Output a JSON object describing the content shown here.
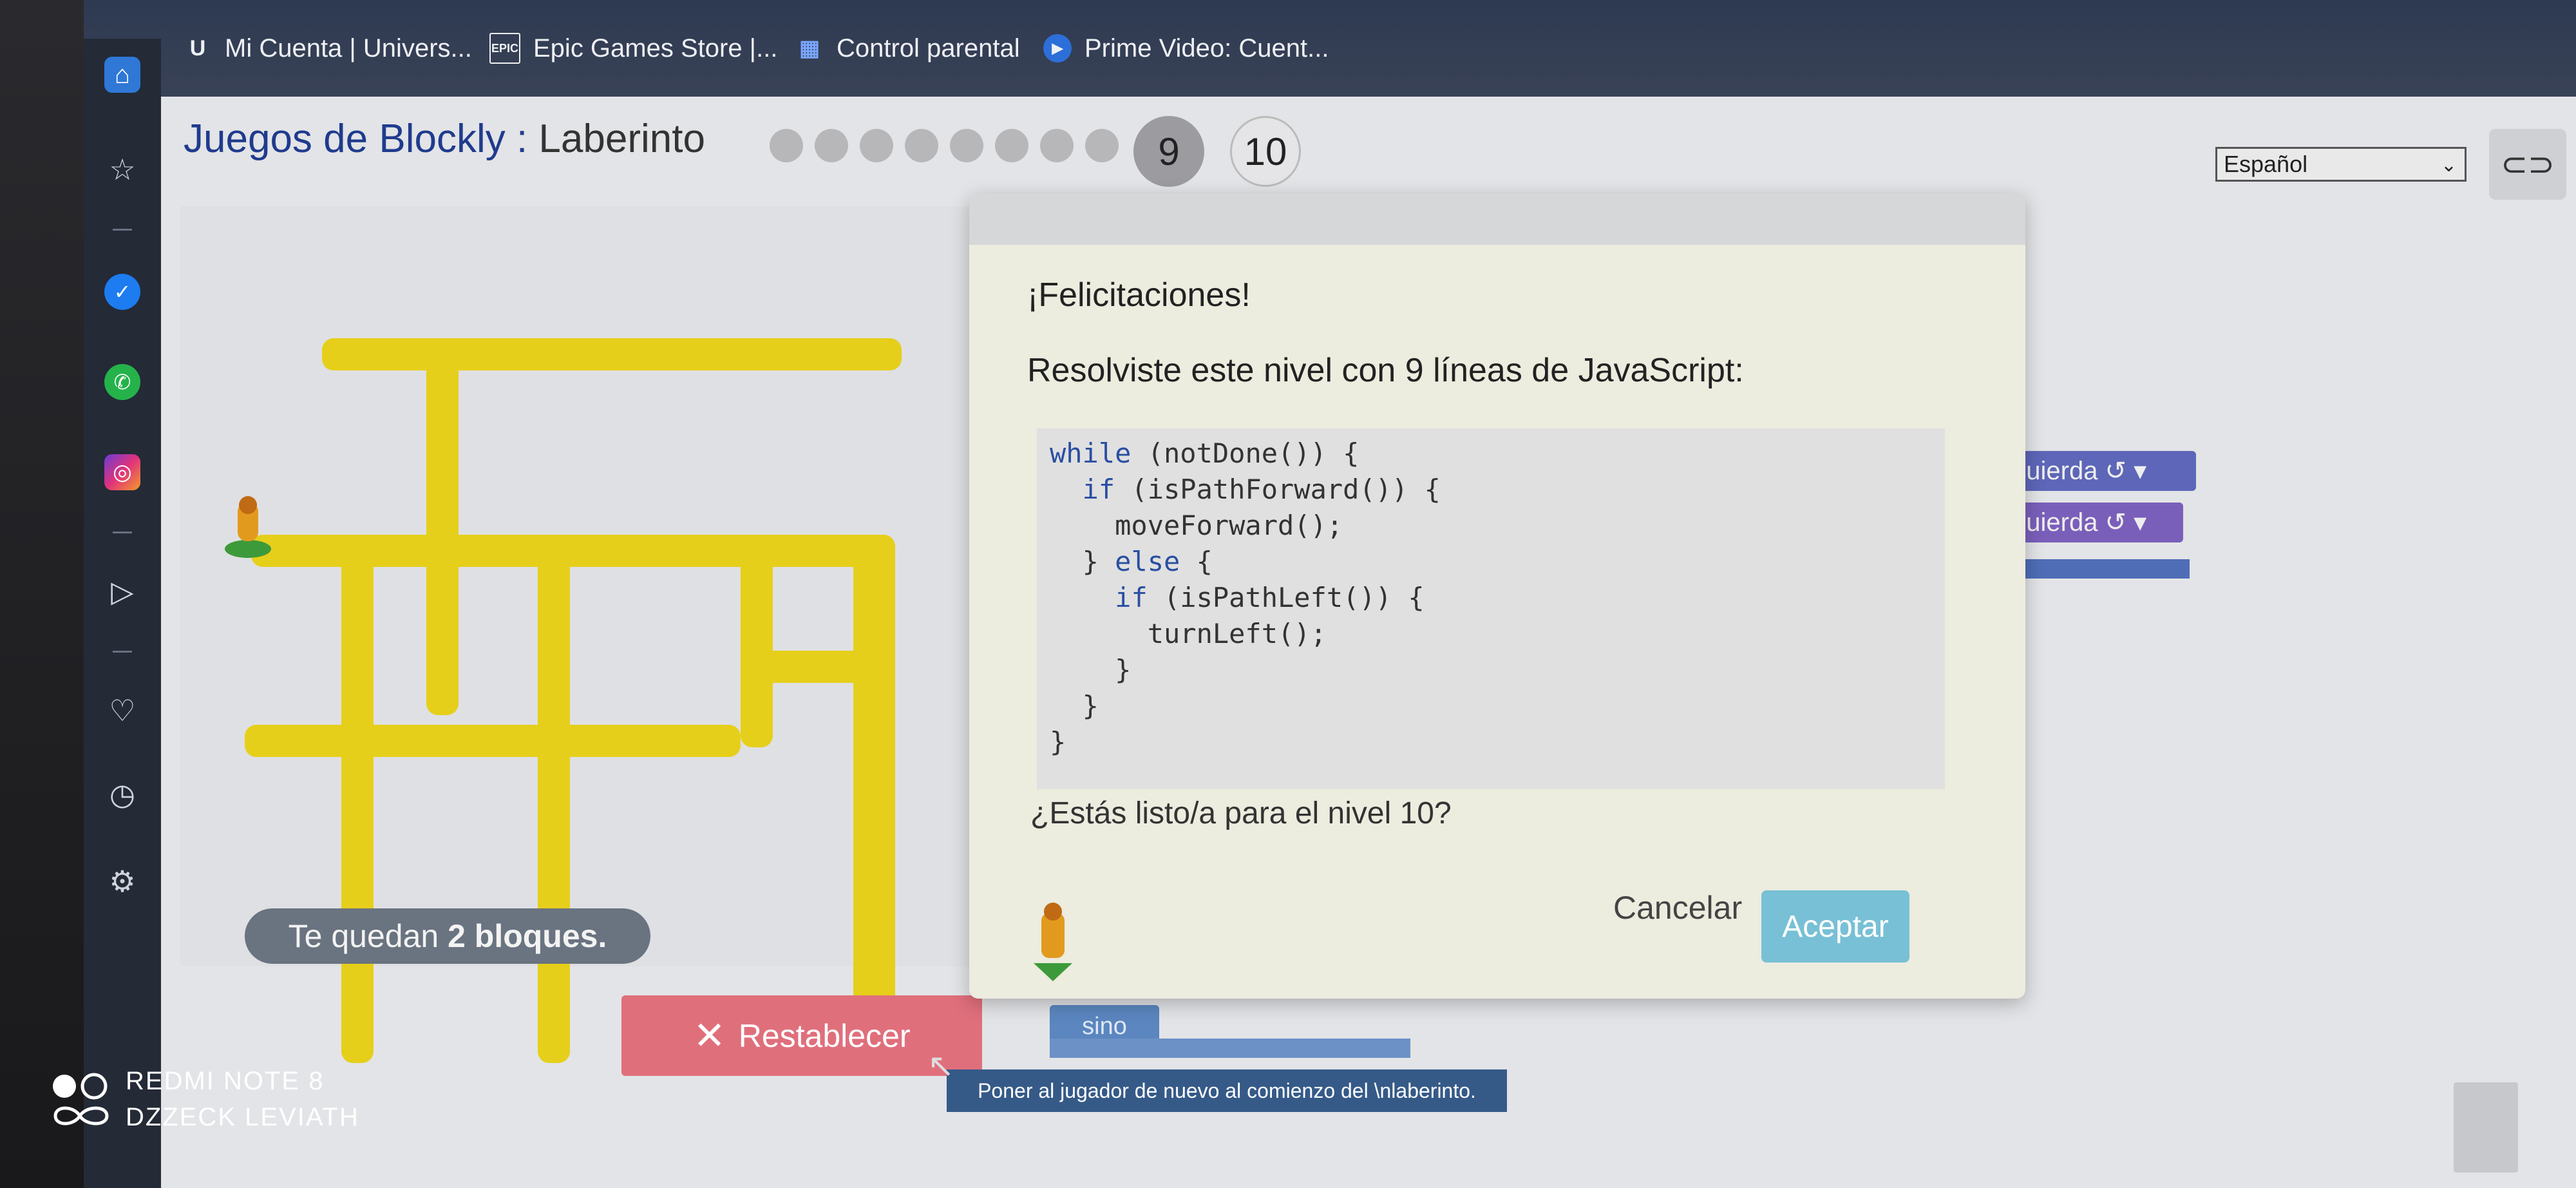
{
  "bookmarks": [
    {
      "icon": "U",
      "label": "Mi Cuenta | Univers..."
    },
    {
      "icon": "EPIC",
      "label": "Epic Games Store |..."
    },
    {
      "icon": "▦",
      "label": "Control parental"
    },
    {
      "icon": "▶",
      "label": "Prime Video: Cuent..."
    }
  ],
  "sidebar": {
    "icons": [
      "home-icon",
      "star-icon",
      "messenger-icon",
      "whatsapp-icon",
      "instagram-icon",
      "send-icon",
      "heart-icon",
      "clock-icon",
      "gear-icon"
    ]
  },
  "header": {
    "app_title": "Juegos de Blockly",
    "separator": " : ",
    "page_title": "Laberinto",
    "current_level": "9",
    "next_level": "10",
    "language": "Español"
  },
  "game": {
    "blocks_left": "Te quedan 2 bloques.",
    "blocks_left_pre": "Te quedan ",
    "blocks_left_num": "2 bloques.",
    "reset_label": "Restablecer",
    "reset_tooltip": "Poner al jugador de nuevo al comienzo del \\nlaberinto."
  },
  "workspace": {
    "block1": "quierda ↺ ▾",
    "block2": "quierda ↺ ▾",
    "sino": "sino"
  },
  "dialog": {
    "congrats": "¡Felicitaciones!",
    "message": "Resolviste este nivel con 9 líneas de JavaScript:",
    "code": [
      "while (notDone()) {",
      "  if (isPathForward()) {",
      "    moveForward();",
      "  } else {",
      "    if (isPathLeft()) {",
      "      turnLeft();",
      "    }",
      "  }",
      "}"
    ],
    "ready": "¿Estás listo/a para el nivel 10?",
    "cancel": "Cancelar",
    "accept": "Aceptar"
  },
  "watermark": {
    "line1": "REDMI NOTE 8",
    "line2": "DZZECK LEVIATH"
  }
}
